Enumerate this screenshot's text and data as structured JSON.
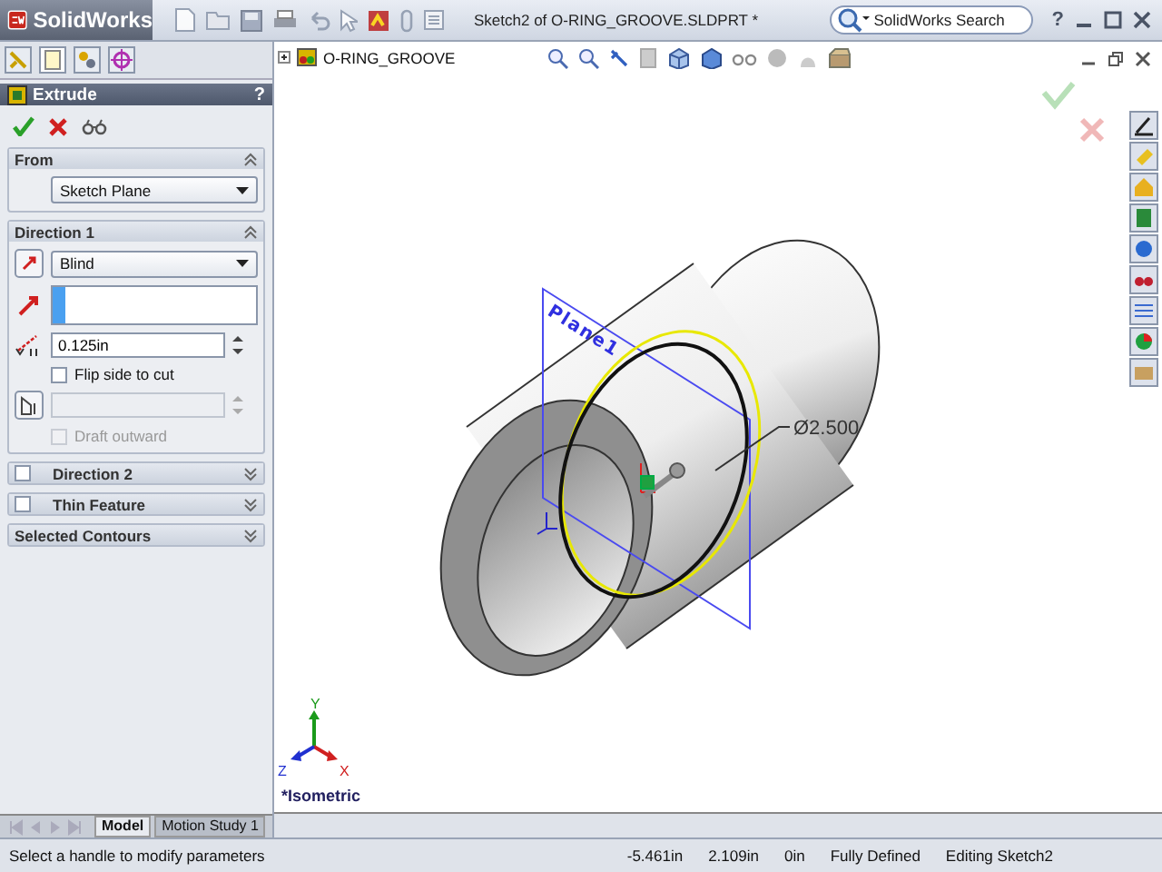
{
  "window": {
    "logo": "SolidWorks",
    "title": "Sketch2 of O-RING_GROOVE.SLDPRT *",
    "search": {
      "placeholder": "SolidWorks Search"
    },
    "help": "?"
  },
  "panel": {
    "title": "Extrude",
    "help": "?",
    "sections": [
      {
        "kind": "from",
        "title": "From",
        "expanded": true,
        "select": "Sketch Plane"
      },
      {
        "kind": "direction",
        "title": "Direction 1",
        "expanded": true,
        "select": "Blind",
        "depth": "0.125in",
        "flip": {
          "label": "Flip side to cut",
          "checked": false
        },
        "draft": {
          "label": "Draft outward",
          "checked": false,
          "disabled": true
        }
      },
      {
        "kind": "option",
        "title": "Direction 2",
        "expanded": false,
        "checked": false
      },
      {
        "kind": "option",
        "title": "Thin Feature",
        "expanded": false,
        "checked": false
      },
      {
        "kind": "plain",
        "title": "Selected Contours",
        "expanded": false
      }
    ]
  },
  "viewport": {
    "tree_item": "O-RING_GROOVE",
    "plane_label": "Plane1",
    "dimension": "Ø2.500",
    "view_label": "*Isometric",
    "triad": {
      "x": "X",
      "y": "Y",
      "z": "Z"
    }
  },
  "bottom_tabs": [
    {
      "label": "Model",
      "selected": true
    },
    {
      "label": "Motion Study 1",
      "selected": false
    }
  ],
  "status_bar": {
    "message": "Select a handle to modify parameters",
    "fields": [
      "-5.461in",
      "2.109in",
      "0in",
      "Fully Defined",
      "Editing Sketch2"
    ]
  }
}
